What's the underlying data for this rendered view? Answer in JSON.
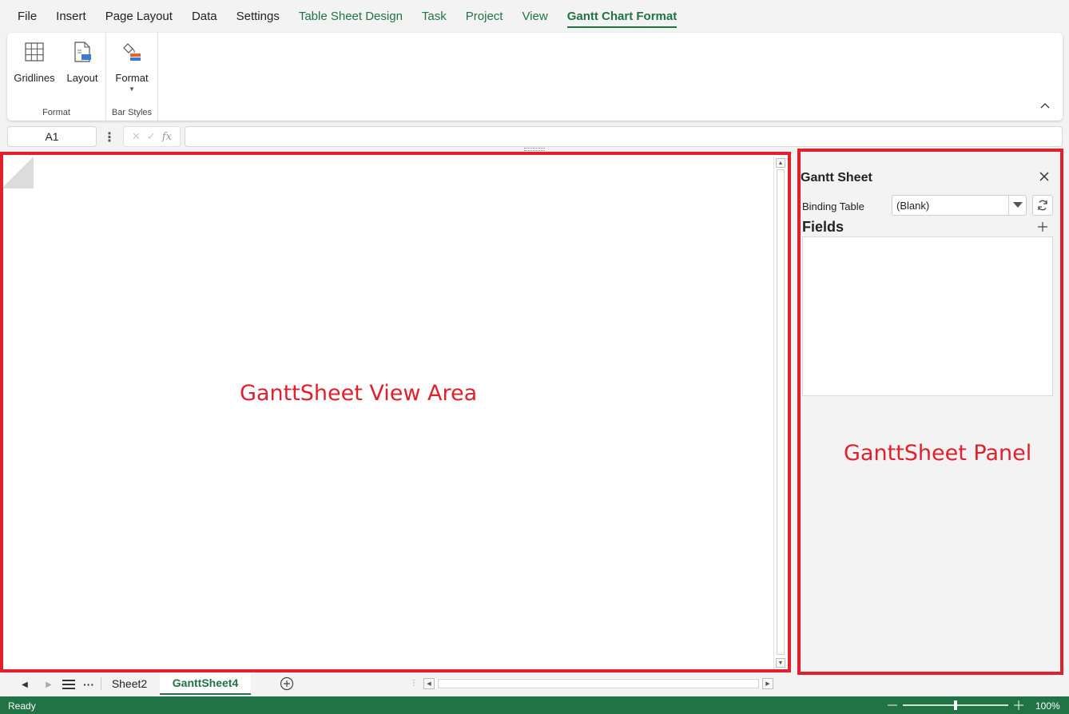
{
  "menu": {
    "items": [
      {
        "label": "File",
        "type": "normal"
      },
      {
        "label": "Insert",
        "type": "normal"
      },
      {
        "label": "Page Layout",
        "type": "normal"
      },
      {
        "label": "Data",
        "type": "normal"
      },
      {
        "label": "Settings",
        "type": "normal"
      },
      {
        "label": "Table Sheet Design",
        "type": "contextual"
      },
      {
        "label": "Task",
        "type": "contextual"
      },
      {
        "label": "Project",
        "type": "contextual"
      },
      {
        "label": "View",
        "type": "contextual"
      },
      {
        "label": "Gantt Chart Format",
        "type": "active"
      }
    ]
  },
  "ribbon": {
    "format_group": {
      "label": "Format",
      "gridlines_label": "Gridlines",
      "layout_label": "Layout"
    },
    "bar_styles_group": {
      "label": "Bar Styles",
      "format_label": "Format"
    }
  },
  "formula_bar": {
    "name_box": "A1",
    "value": ""
  },
  "view_area": {
    "annotation": "GanttSheet View Area"
  },
  "panel": {
    "title": "Gantt Sheet",
    "binding_label": "Binding Table",
    "binding_value": "(Blank)",
    "fields_label": "Fields",
    "annotation": "GanttSheet Panel"
  },
  "tabs": {
    "sheets": [
      "Sheet2",
      "GanttSheet4"
    ],
    "active": "GanttSheet4"
  },
  "status": {
    "text": "Ready",
    "zoom": "100%",
    "zoom_fraction": 0.5
  },
  "colors": {
    "accent": "#217346",
    "annotation": "#e0202c"
  }
}
